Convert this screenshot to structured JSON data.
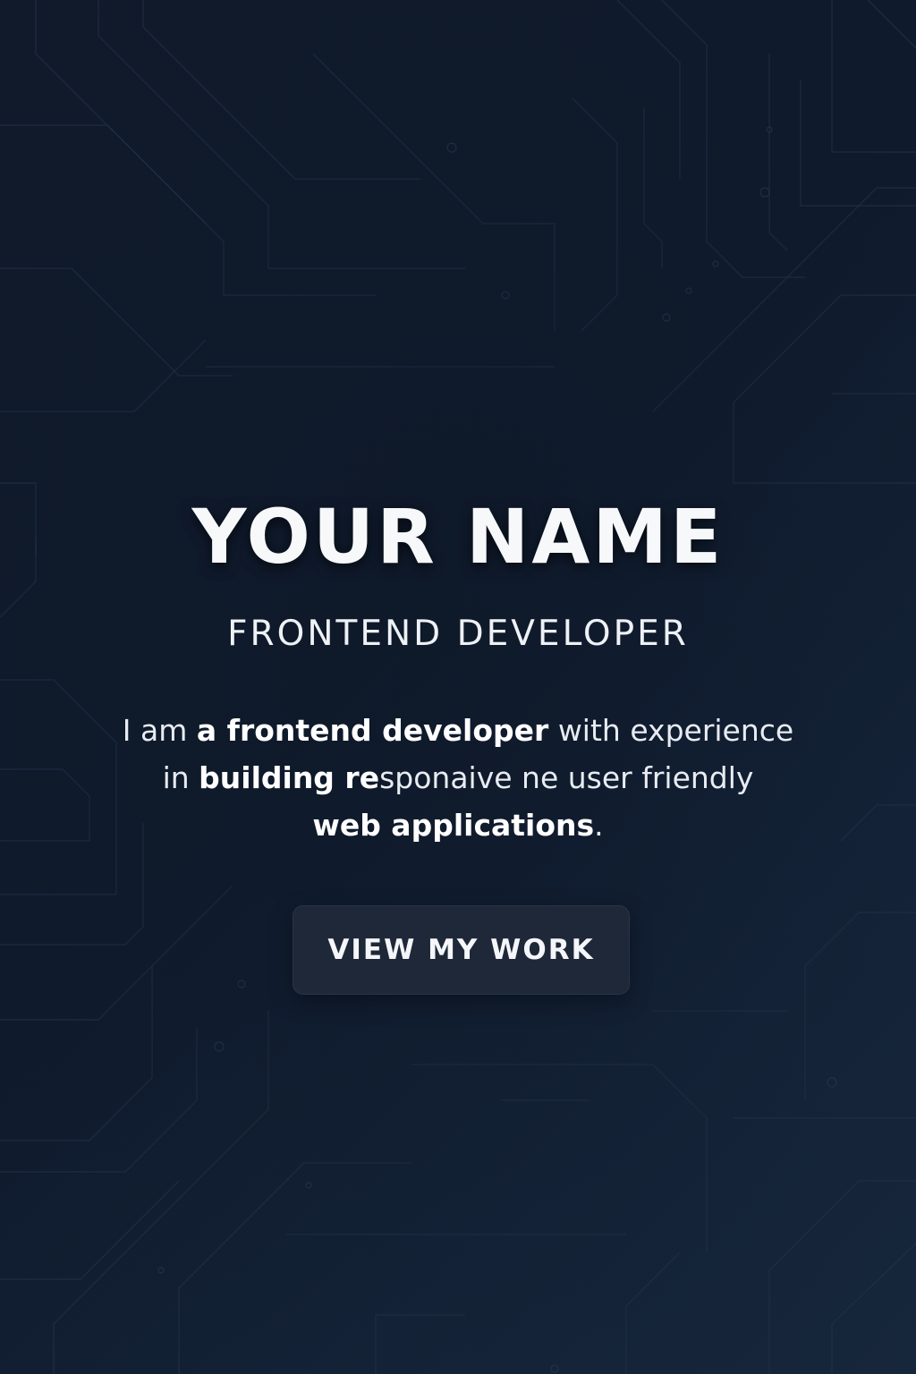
{
  "hero": {
    "name": "YOUR NAME",
    "role": "FRONTEND DEVELOPER",
    "bio": {
      "line1_a": "I am ",
      "line1_b": "a frontend developer",
      "line1_c": " with experience",
      "line2_a": "in ",
      "line2_b": "building re",
      "line2_c": "sponaive ne user friendly",
      "line3_a": "web applications",
      "line3_b": "."
    },
    "cta_label": "VIEW MY WORK"
  },
  "colors": {
    "background": "#101a2b",
    "circuit_lines": "#223249",
    "button_bg": "#1f2838",
    "text": "#ffffff"
  }
}
